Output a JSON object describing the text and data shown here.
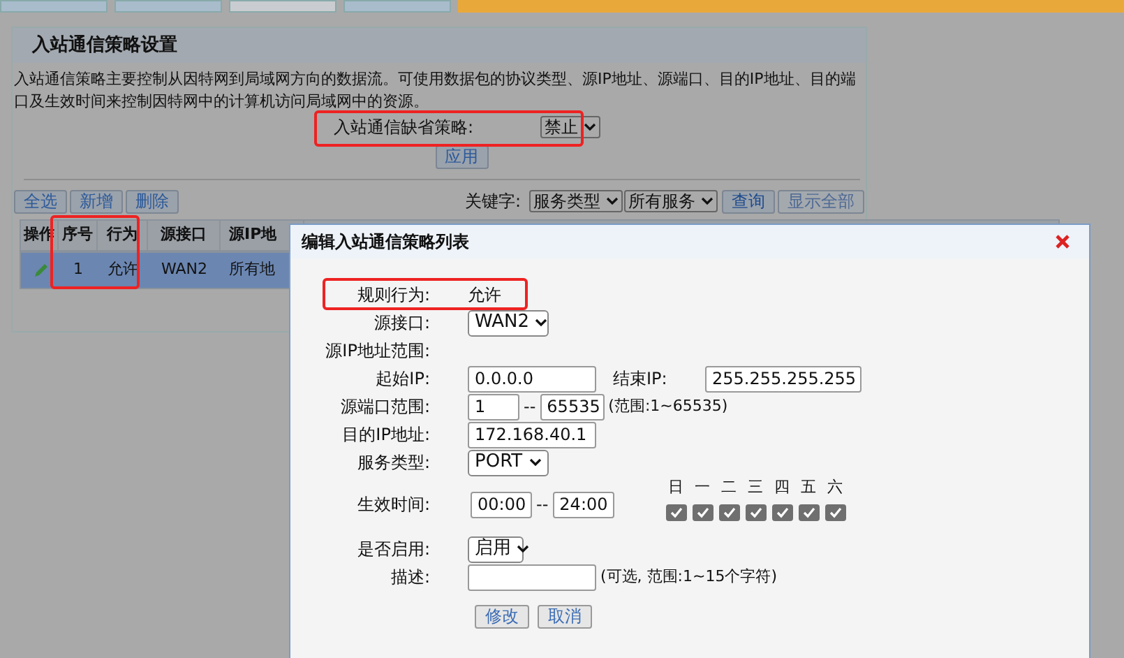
{
  "tabs": [
    {
      "selected": false
    },
    {
      "selected": false
    },
    {
      "selected": true
    },
    {
      "selected": false
    }
  ],
  "panel": {
    "title": "入站通信策略设置",
    "description": "入站通信策略主要控制从因特网到局域网方向的数据流。可使用数据包的协议类型、源IP地址、源端口、目的IP地址、目的端口及生效时间来控制因特网中的计算机访问局域网中的资源。",
    "default_policy": {
      "label": "入站通信缺省策略:",
      "value": "禁止"
    },
    "apply_button": "应用",
    "toolbar_buttons": [
      "全选",
      "新增",
      "删除"
    ],
    "keyword": {
      "label": "关键字:",
      "selects": [
        "服务类型",
        "所有服务"
      ],
      "buttons": [
        {
          "label": "查询",
          "disabled": false
        },
        {
          "label": "显示全部",
          "disabled": true
        }
      ]
    },
    "table": {
      "action_column": "操作",
      "columns": [
        "序号",
        "行为",
        "源接口",
        "源IP地"
      ],
      "rows": [
        {
          "selected": true,
          "cells": [
            "1",
            "允许",
            "WAN2",
            "所有地"
          ]
        }
      ]
    }
  },
  "dialog": {
    "title": "编辑入站通信策略列表",
    "fields": [
      {
        "kind": "text",
        "label": "规则行为:",
        "value": "允许"
      },
      {
        "kind": "select",
        "label": "源接口:",
        "value": "WAN2"
      },
      {
        "kind": "heading",
        "label": "源IP地址范围:"
      },
      {
        "kind": "iprange",
        "label": "起始IP:",
        "value": "0.0.0.0",
        "label2": "结束IP:",
        "value2": "255.255.255.255"
      },
      {
        "kind": "range",
        "label": "源端口范围:",
        "value": "1",
        "sep": "--",
        "value2": "65535",
        "hint": "(范围:1~65535)"
      },
      {
        "kind": "input",
        "label": "目的IP地址:",
        "value": "172.168.40.1"
      },
      {
        "kind": "select",
        "label": "服务类型:",
        "value": "PORT"
      },
      {
        "kind": "time",
        "label": "生效时间:",
        "value": "00:00",
        "sep": "--",
        "value2": "24:00"
      },
      {
        "kind": "smallselect",
        "label": "是否启用:",
        "value": "启用"
      },
      {
        "kind": "input",
        "label": "描述:",
        "hint": "(可选, 范围:1~15个字符)"
      }
    ],
    "days": [
      {
        "label": "日",
        "checked": true
      },
      {
        "label": "一",
        "checked": true
      },
      {
        "label": "二",
        "checked": true
      },
      {
        "label": "三",
        "checked": true
      },
      {
        "label": "四",
        "checked": true
      },
      {
        "label": "五",
        "checked": true
      },
      {
        "label": "六",
        "checked": true
      }
    ],
    "buttons": [
      "修改",
      "取消"
    ]
  }
}
